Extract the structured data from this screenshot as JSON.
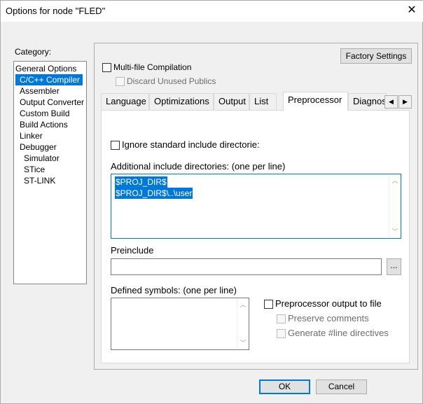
{
  "window": {
    "title": "Options for node \"FLED\"",
    "close_glyph": "✕"
  },
  "category": {
    "label": "Category:",
    "items": [
      "General Options",
      "C/C++ Compiler",
      "Assembler",
      "Output Converter",
      "Custom Build",
      "Build Actions",
      "Linker",
      "Debugger",
      "Simulator",
      "STice",
      "ST-LINK"
    ],
    "selected_index": 1
  },
  "top": {
    "factory_settings": "Factory Settings",
    "multifile": {
      "label": "Multi-file Compilation",
      "checked": false
    },
    "discard": {
      "label": "Discard Unused Publics",
      "checked": false,
      "enabled": false
    }
  },
  "tabs": {
    "items": [
      "Language",
      "Optimizations",
      "Output",
      "List",
      "Preprocessor",
      "Diagnos"
    ],
    "active_index": 4,
    "scroll_left": "◀",
    "scroll_right": "▶"
  },
  "preprocessor": {
    "ignore_std": {
      "label": "Ignore standard include directorie:",
      "checked": false
    },
    "include_dirs": {
      "label": "Additional include directories: (one per line)",
      "lines": [
        "$PROJ_DIR$",
        "$PROJ_DIR$\\..\\user"
      ]
    },
    "preinclude": {
      "label": "Preinclude",
      "value": "",
      "browse": "..."
    },
    "defined_symbols": {
      "label": "Defined symbols: (one per line)",
      "value": ""
    },
    "pp_output": {
      "label": "Preprocessor output to file",
      "checked": false
    },
    "preserve_comments": {
      "label": "Preserve comments",
      "checked": false,
      "enabled": false
    },
    "line_directives": {
      "label": "Generate #line directives",
      "checked": false,
      "enabled": false
    }
  },
  "footer": {
    "ok": "OK",
    "cancel": "Cancel"
  },
  "colors": {
    "selection": "#0078d7",
    "focus_border": "#0078d7"
  }
}
